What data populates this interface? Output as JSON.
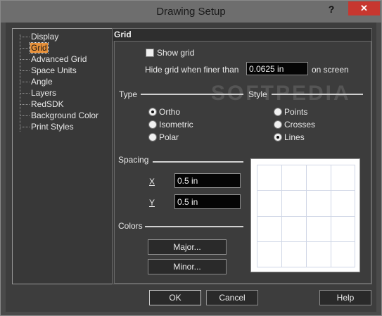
{
  "window": {
    "title": "Drawing Setup",
    "help_glyph": "?",
    "close_glyph": "✕"
  },
  "tree": {
    "items": [
      {
        "label": "Display"
      },
      {
        "label": "Grid"
      },
      {
        "label": "Advanced Grid"
      },
      {
        "label": "Space Units"
      },
      {
        "label": "Angle"
      },
      {
        "label": "Layers"
      },
      {
        "label": "RedSDK"
      },
      {
        "label": "Background Color"
      },
      {
        "label": "Print Styles"
      }
    ],
    "selected": "Grid"
  },
  "panel": {
    "title": "Grid",
    "show_grid": {
      "label": "Show grid",
      "checked": false
    },
    "hide_grid": {
      "label": "Hide grid when finer than",
      "value": "0.0625 in",
      "suffix": "on screen"
    },
    "type": {
      "label": "Type",
      "options": [
        {
          "label": "Ortho",
          "checked": true
        },
        {
          "label": "Isometric",
          "checked": false
        },
        {
          "label": "Polar",
          "checked": false
        }
      ]
    },
    "style": {
      "label": "Style",
      "options": [
        {
          "label": "Points",
          "checked": false
        },
        {
          "label": "Crosses",
          "checked": false
        },
        {
          "label": "Lines",
          "checked": true
        }
      ]
    },
    "spacing": {
      "label": "Spacing",
      "x_label": "X",
      "x_value": "0.5 in",
      "y_label": "Y",
      "y_value": "0.5 in"
    },
    "colors": {
      "label": "Colors",
      "major_button": "Major...",
      "minor_button": "Minor..."
    }
  },
  "footer": {
    "ok": "OK",
    "cancel": "Cancel",
    "help": "Help"
  },
  "watermark": "SOFTPEDIA"
}
